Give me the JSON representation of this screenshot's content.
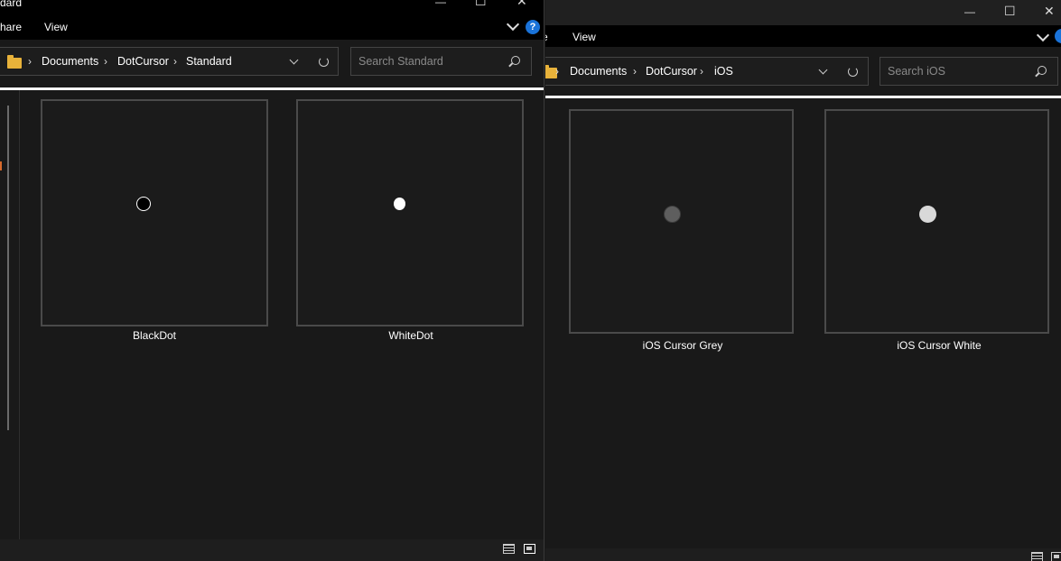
{
  "windows": {
    "ios": {
      "ribbon": {
        "partial_item": "e",
        "view_label": "View"
      },
      "breadcrumb": [
        "Documents",
        "DotCursor",
        "iOS"
      ],
      "search_placeholder": "Search iOS",
      "items": [
        {
          "label": "iOS Cursor Grey",
          "dot_color": "#5e5e5e"
        },
        {
          "label": "iOS Cursor White",
          "dot_color": "#d9d9d9"
        }
      ]
    },
    "standard": {
      "title_partial": "dard",
      "ribbon": {
        "share_partial": "hare",
        "view_label": "View",
        "help_label": "?"
      },
      "breadcrumb": [
        "Documents",
        "DotCursor",
        "Standard"
      ],
      "search_placeholder": "Search Standard",
      "items": [
        {
          "label": "BlackDot",
          "dot_color": "#000000"
        },
        {
          "label": "WhiteDot",
          "dot_color": "#ffffff"
        }
      ]
    }
  },
  "icons": {
    "separator": "›",
    "minimize": "—",
    "maximize": "☐",
    "close": "✕"
  }
}
